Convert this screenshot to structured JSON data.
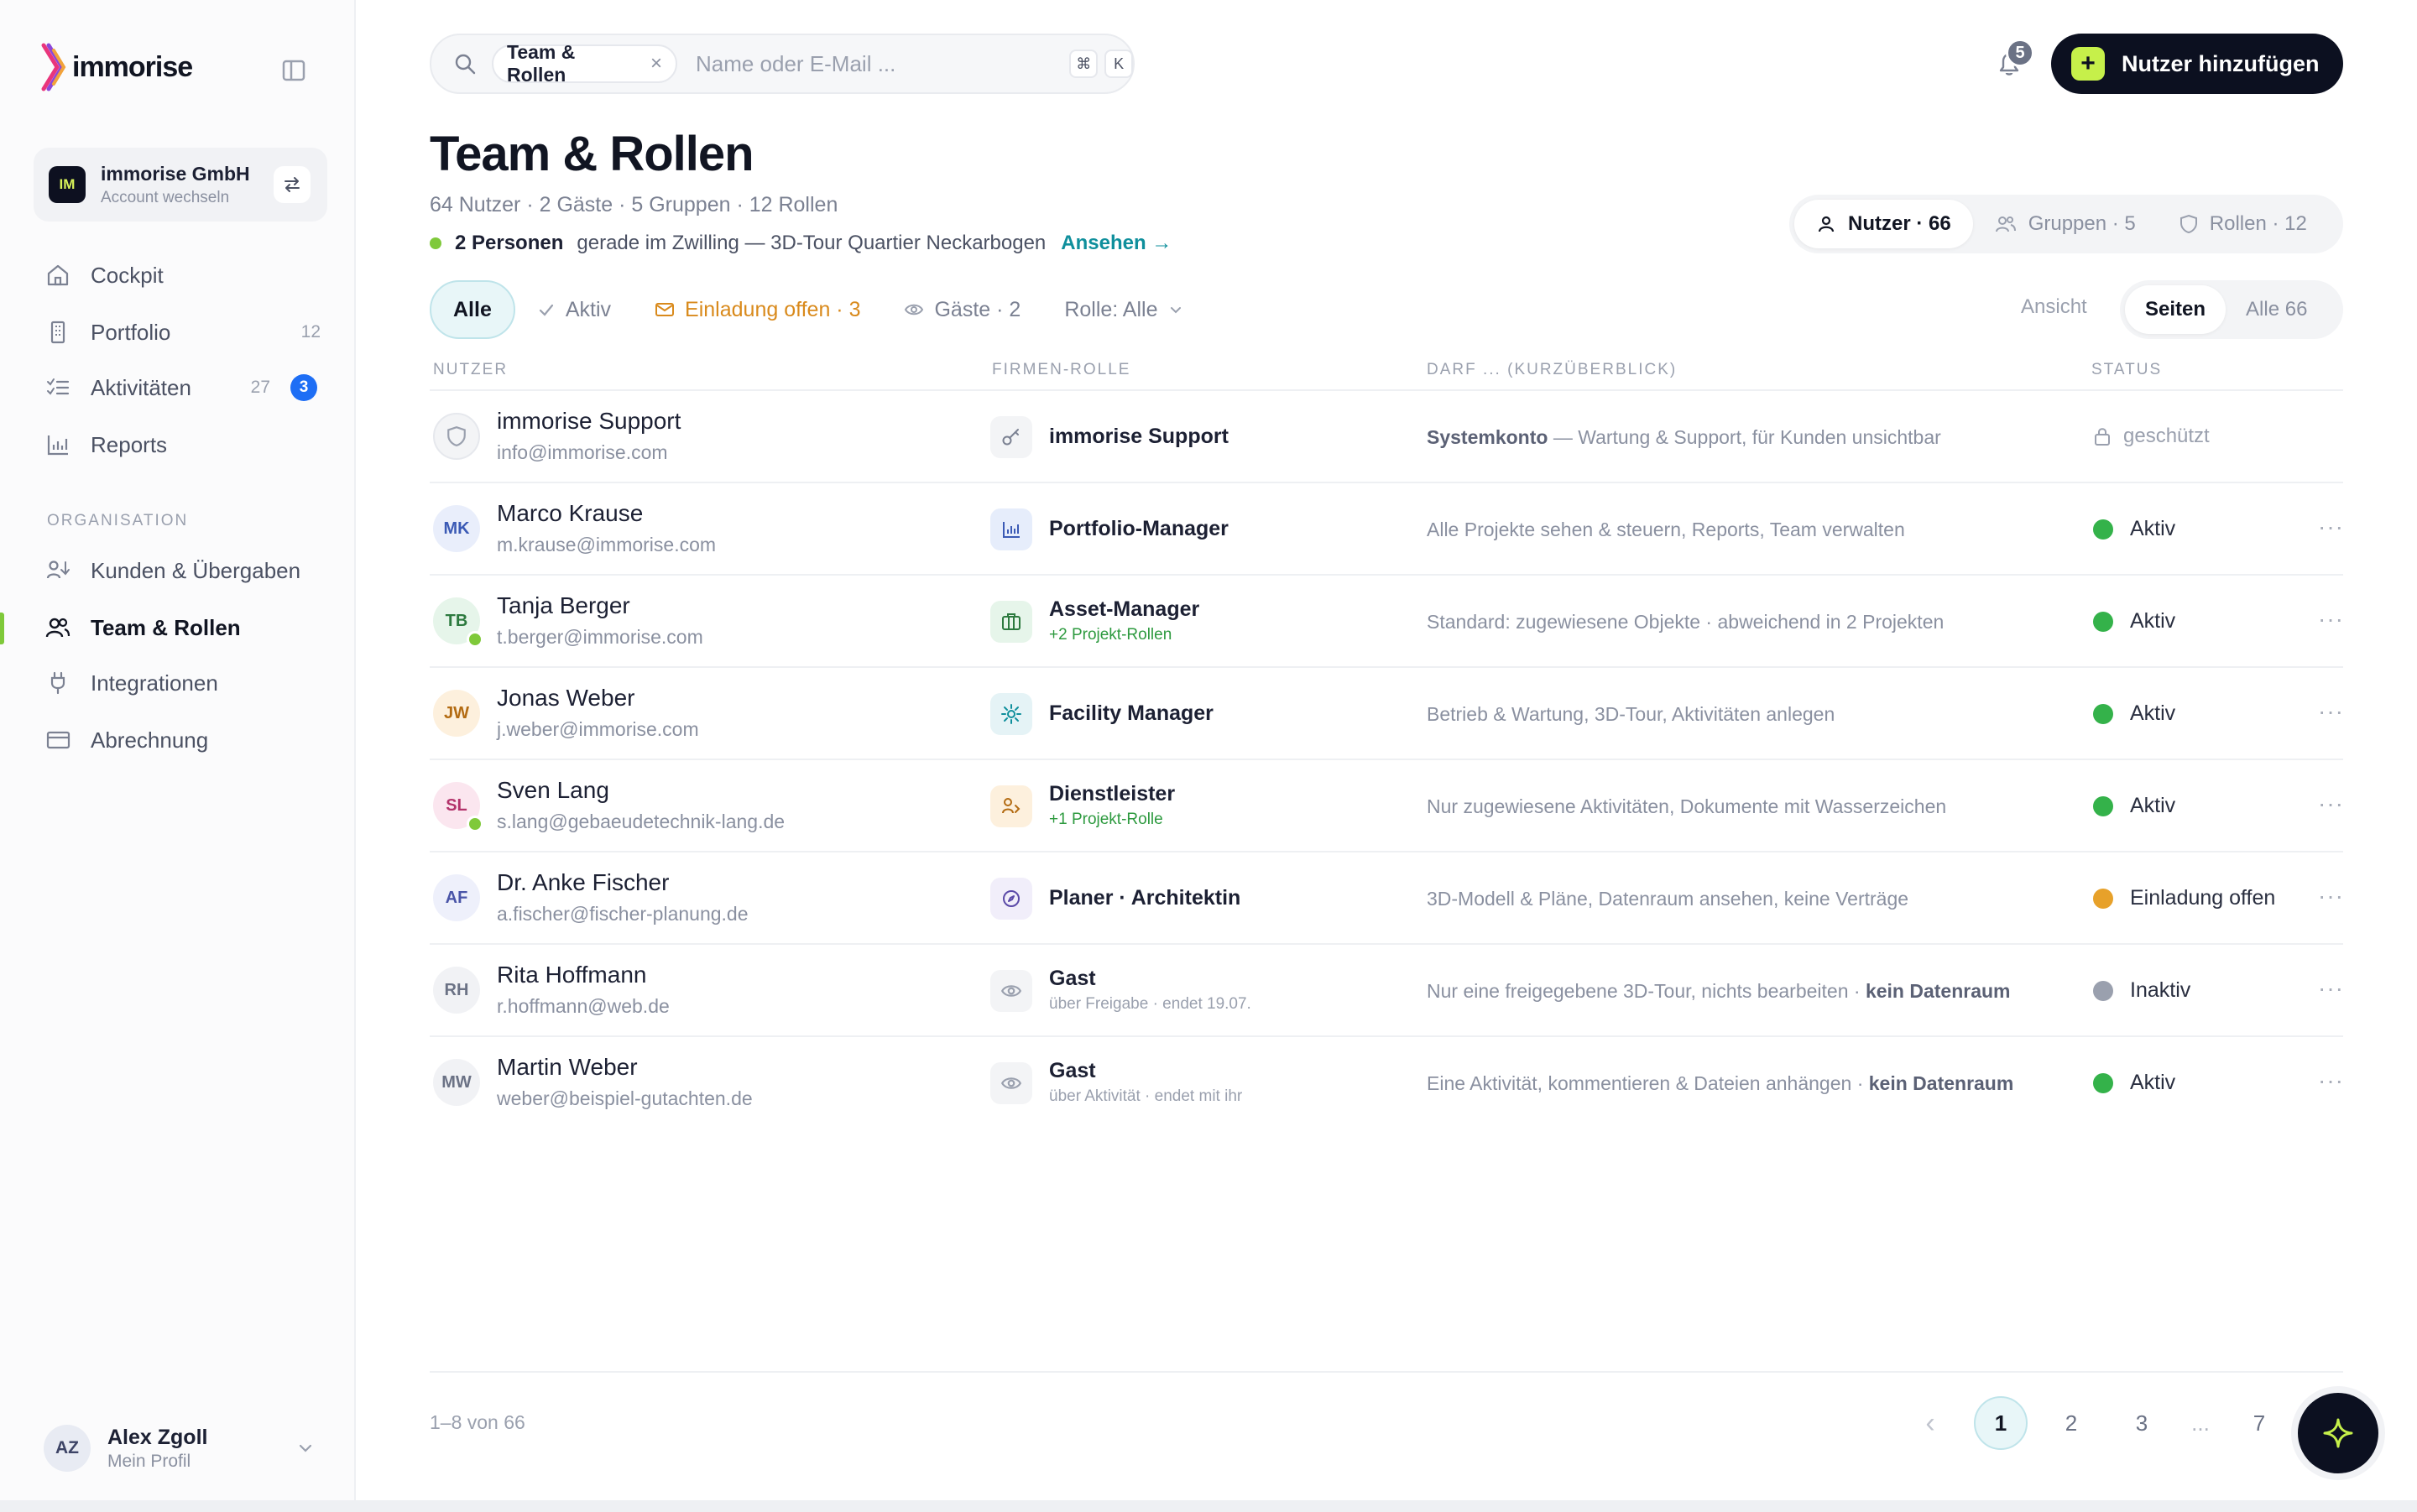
{
  "brand": {
    "name": "immorise"
  },
  "org": {
    "badge": "IM",
    "name": "immorise GmbH",
    "sub": "Account wechseln"
  },
  "nav": {
    "main": [
      {
        "label": "Cockpit",
        "icon": "home-icon"
      },
      {
        "label": "Portfolio",
        "icon": "building-icon",
        "count": "12"
      },
      {
        "label": "Aktivitäten",
        "icon": "checklist-icon",
        "count": "27",
        "badge": "3"
      },
      {
        "label": "Reports",
        "icon": "bar-chart-icon"
      }
    ],
    "section": "ORGANISATION",
    "org": [
      {
        "label": "Kunden & Übergaben",
        "icon": "users-handoff-icon"
      },
      {
        "label": "Team & Rollen",
        "icon": "users-icon"
      },
      {
        "label": "Integrationen",
        "icon": "plug-icon"
      },
      {
        "label": "Abrechnung",
        "icon": "credit-card-icon"
      }
    ]
  },
  "profile": {
    "initials": "AZ",
    "name": "Alex Zgoll",
    "sub": "Mein Profil"
  },
  "search": {
    "chip": "Team & Rollen",
    "chip_close": "×",
    "placeholder": "Name oder E-Mail ...",
    "kbd1": "⌘",
    "kbd2": "K"
  },
  "notifications": {
    "count": "5"
  },
  "add_user": {
    "label": "Nutzer hinzufügen",
    "plus": "+"
  },
  "page": {
    "title": "Team & Rollen",
    "stats": "64 Nutzer · 2 Gäste · 5 Gruppen · 12 Rollen",
    "live_strong": "2 Personen",
    "live_text": "gerade im Zwilling — 3D-Tour Quartier Neckarbogen",
    "live_link": "Ansehen →"
  },
  "view_tabs": [
    {
      "label": "Nutzer · 66"
    },
    {
      "label": "Gruppen · 5"
    },
    {
      "label": "Rollen · 12"
    }
  ],
  "filters": [
    {
      "label": "Alle"
    },
    {
      "label": "Aktiv"
    },
    {
      "label": "Einladung offen · 3"
    },
    {
      "label": "Gäste · 2"
    },
    {
      "label": "Rolle: Alle"
    }
  ],
  "view": {
    "label": "Ansicht",
    "options": [
      "Seiten",
      "Alle 66"
    ]
  },
  "table": {
    "headers": [
      "NUTZER",
      "FIRMEN-ROLLE",
      "DARF ... (KURZÜBERBLICK)",
      "STATUS"
    ],
    "rows": [
      {
        "initials": "",
        "name": "immorise Support",
        "email": "info@immorise.com",
        "role": "immorise Support",
        "role_sub": "",
        "desc_strong": "Systemkonto",
        "desc": " — Wartung & Support, für Kunden unsichtbar",
        "desc_tail": "",
        "status": "geschützt",
        "online": false
      },
      {
        "initials": "MK",
        "name": "Marco Krause",
        "email": "m.krause@immorise.com",
        "role": "Portfolio-Manager",
        "role_sub": "",
        "desc_strong": "",
        "desc": "Alle Projekte sehen & steuern, Reports, Team verwalten",
        "desc_tail": "",
        "status": "Aktiv",
        "online": false
      },
      {
        "initials": "TB",
        "name": "Tanja Berger",
        "email": "t.berger@immorise.com",
        "role": "Asset-Manager",
        "role_sub": "+2 Projekt-Rollen",
        "desc_strong": "",
        "desc": "Standard: zugewiesene Objekte · abweichend in 2 Projekten",
        "desc_tail": "",
        "status": "Aktiv",
        "online": true
      },
      {
        "initials": "JW",
        "name": "Jonas Weber",
        "email": "j.weber@immorise.com",
        "role": "Facility Manager",
        "role_sub": "",
        "desc_strong": "",
        "desc": "Betrieb & Wartung, 3D-Tour, Aktivitäten anlegen",
        "desc_tail": "",
        "status": "Aktiv",
        "online": false
      },
      {
        "initials": "SL",
        "name": "Sven Lang",
        "email": "s.lang@gebaeudetechnik-lang.de",
        "role": "Dienstleister",
        "role_sub": "+1 Projekt-Rolle",
        "desc_strong": "",
        "desc": "Nur zugewiesene Aktivitäten, Dokumente mit Wasserzeichen",
        "desc_tail": "",
        "status": "Aktiv",
        "online": true
      },
      {
        "initials": "AF",
        "name": "Dr. Anke Fischer",
        "email": "a.fischer@fischer-planung.de",
        "role": "Planer · Architektin",
        "role_sub": "",
        "desc_strong": "",
        "desc": "3D-Modell & Pläne, Datenraum ansehen, keine Verträge",
        "desc_tail": "",
        "status": "Einladung offen",
        "online": false
      },
      {
        "initials": "RH",
        "name": "Rita Hoffmann",
        "email": "r.hoffmann@web.de",
        "role": "Gast",
        "role_sub": "über Freigabe · endet 19.07.",
        "desc_strong": "",
        "desc": "Nur eine freigegebene 3D-Tour, nichts bearbeiten · ",
        "desc_tail": "kein Datenraum",
        "status": "Inaktiv",
        "online": false
      },
      {
        "initials": "MW",
        "name": "Martin Weber",
        "email": "weber@beispiel-gutachten.de",
        "role": "Gast",
        "role_sub": "über Aktivität · endet mit ihr",
        "desc_strong": "",
        "desc": "Eine Aktivität, kommentieren & Dateien anhängen · ",
        "desc_tail": "kein Datenraum",
        "status": "Aktiv",
        "online": false
      }
    ],
    "more": "···"
  },
  "pagination": {
    "range": "1–8 von 66",
    "prev": "‹",
    "pages": [
      "1",
      "2",
      "3",
      "...",
      "7"
    ]
  },
  "colors": {
    "accent": "#0f8f9c",
    "brand_dark": "#0c1020",
    "brand_lime": "#c6f04a",
    "status_active": "#34b24a",
    "status_invited": "#e7a12a",
    "status_inactive": "#9aa0ae",
    "badge_blue": "#1e6ef5"
  }
}
